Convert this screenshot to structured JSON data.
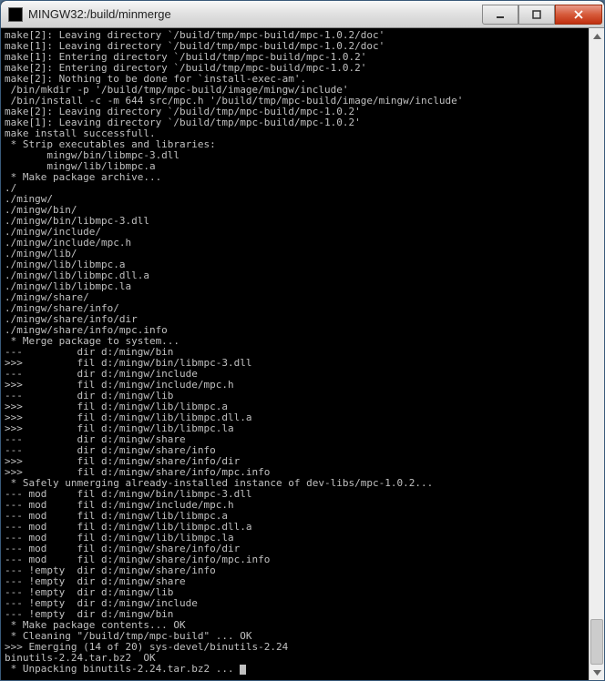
{
  "window": {
    "title": "MINGW32:/build/minmerge"
  },
  "buttons": {
    "minimize": "minimize",
    "maximize": "maximize",
    "close": "close"
  },
  "terminal": {
    "lines": [
      "make[2]: Leaving directory `/build/tmp/mpc-build/mpc-1.0.2/doc'",
      "make[1]: Leaving directory `/build/tmp/mpc-build/mpc-1.0.2/doc'",
      "make[1]: Entering directory `/build/tmp/mpc-build/mpc-1.0.2'",
      "make[2]: Entering directory `/build/tmp/mpc-build/mpc-1.0.2'",
      "make[2]: Nothing to be done for `install-exec-am'.",
      " /bin/mkdir -p '/build/tmp/mpc-build/image/mingw/include'",
      " /bin/install -c -m 644 src/mpc.h '/build/tmp/mpc-build/image/mingw/include'",
      "make[2]: Leaving directory `/build/tmp/mpc-build/mpc-1.0.2'",
      "make[1]: Leaving directory `/build/tmp/mpc-build/mpc-1.0.2'",
      "make install successfull.",
      " * Strip executables and libraries:",
      "       mingw/bin/libmpc-3.dll",
      "       mingw/lib/libmpc.a",
      " * Make package archive...",
      "./",
      "./mingw/",
      "./mingw/bin/",
      "./mingw/bin/libmpc-3.dll",
      "./mingw/include/",
      "./mingw/include/mpc.h",
      "./mingw/lib/",
      "./mingw/lib/libmpc.a",
      "./mingw/lib/libmpc.dll.a",
      "./mingw/lib/libmpc.la",
      "./mingw/share/",
      "./mingw/share/info/",
      "./mingw/share/info/dir",
      "./mingw/share/info/mpc.info",
      " * Merge package to system...",
      "---         dir d:/mingw/bin",
      ">>>         fil d:/mingw/bin/libmpc-3.dll",
      "---         dir d:/mingw/include",
      ">>>         fil d:/mingw/include/mpc.h",
      "---         dir d:/mingw/lib",
      ">>>         fil d:/mingw/lib/libmpc.a",
      ">>>         fil d:/mingw/lib/libmpc.dll.a",
      ">>>         fil d:/mingw/lib/libmpc.la",
      "---         dir d:/mingw/share",
      "---         dir d:/mingw/share/info",
      ">>>         fil d:/mingw/share/info/dir",
      ">>>         fil d:/mingw/share/info/mpc.info",
      " * Safely unmerging already-installed instance of dev-libs/mpc-1.0.2...",
      "--- mod     fil d:/mingw/bin/libmpc-3.dll",
      "--- mod     fil d:/mingw/include/mpc.h",
      "--- mod     fil d:/mingw/lib/libmpc.a",
      "--- mod     fil d:/mingw/lib/libmpc.dll.a",
      "--- mod     fil d:/mingw/lib/libmpc.la",
      "--- mod     fil d:/mingw/share/info/dir",
      "--- mod     fil d:/mingw/share/info/mpc.info",
      "--- !empty  dir d:/mingw/share/info",
      "--- !empty  dir d:/mingw/share",
      "--- !empty  dir d:/mingw/lib",
      "--- !empty  dir d:/mingw/include",
      "--- !empty  dir d:/mingw/bin",
      " * Make package contents... OK",
      " * Cleaning \"/build/tmp/mpc-build\" ... OK",
      ">>> Emerging (14 of 20) sys-devel/binutils-2.24",
      "binutils-2.24.tar.bz2  OK",
      " * Unpacking binutils-2.24.tar.bz2 ... "
    ]
  }
}
